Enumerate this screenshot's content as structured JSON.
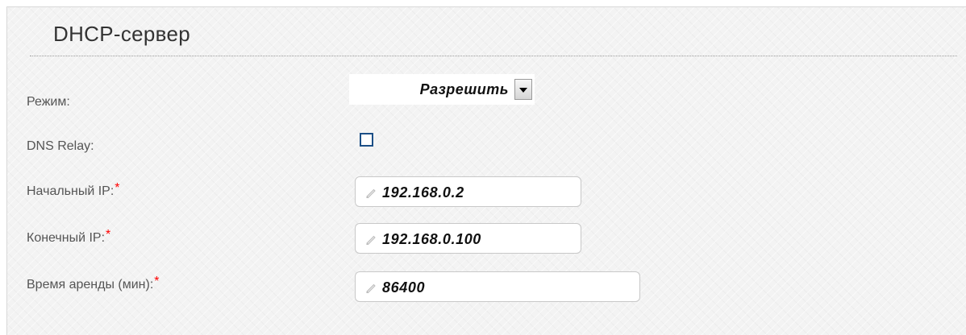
{
  "section": {
    "title": "DHCP-сервер"
  },
  "fields": {
    "mode": {
      "label": "Режим:",
      "value": "Разрешить"
    },
    "dns_relay": {
      "label": "DNS Relay:",
      "checked": false
    },
    "start_ip": {
      "label": "Начальный IP:",
      "required": "*",
      "value": "192.168.0.2"
    },
    "end_ip": {
      "label": "Конечный IP:",
      "required": "*",
      "value": "192.168.0.100"
    },
    "lease_time": {
      "label": "Время аренды (мин):",
      "required": "*",
      "value": "86400"
    }
  },
  "icons": {
    "select_arrow": "chevron-down-icon",
    "field_edit": "pencil-icon"
  },
  "colors": {
    "required_marker": "#ff0000",
    "checkbox_border": "#1c4f86"
  }
}
